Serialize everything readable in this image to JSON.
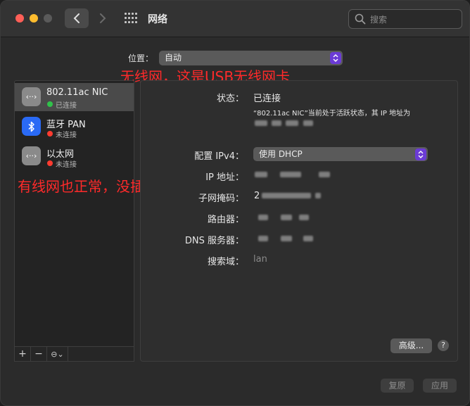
{
  "window": {
    "title": "网络"
  },
  "search": {
    "placeholder": "搜索"
  },
  "location": {
    "label": "位置：",
    "value": "自动"
  },
  "annotations": {
    "top": "无线网，这是USB无线网卡",
    "left": "有线网也正常，没插网线"
  },
  "sidebar": {
    "services": [
      {
        "name": "802.11ac NIC",
        "status": "已连接",
        "status_color": "#30c24a",
        "icon": "ethernet-arrows-icon",
        "selected": true
      },
      {
        "name": "蓝牙 PAN",
        "status": "未连接",
        "status_color": "#ff3b30",
        "icon": "bluetooth-icon",
        "selected": false
      },
      {
        "name": "以太网",
        "status": "未连接",
        "status_color": "#ff3b30",
        "icon": "ethernet-arrows-icon",
        "selected": false
      }
    ],
    "toolbar": {
      "add": "+",
      "remove": "−",
      "action": "⊖⌄"
    }
  },
  "detail": {
    "status_label": "状态：",
    "status_value": "已连接",
    "status_desc": "“802.11ac NIC”当前处于活跃状态，其 IP 地址为",
    "ipv4_label": "配置 IPv4：",
    "ipv4_value": "使用 DHCP",
    "ip_label": "IP 地址：",
    "subnet_label": "子网掩码：",
    "subnet_prefix": "2",
    "router_label": "路由器：",
    "dns_label": "DNS 服务器：",
    "search_domain_label": "搜索域：",
    "search_domain_value": "lan",
    "advanced_button": "高级...",
    "help_button": "?"
  },
  "footer": {
    "revert": "复原",
    "apply": "应用"
  },
  "colors": {
    "accent": "#6b3bd6",
    "annotation": "#ff2a2a"
  }
}
